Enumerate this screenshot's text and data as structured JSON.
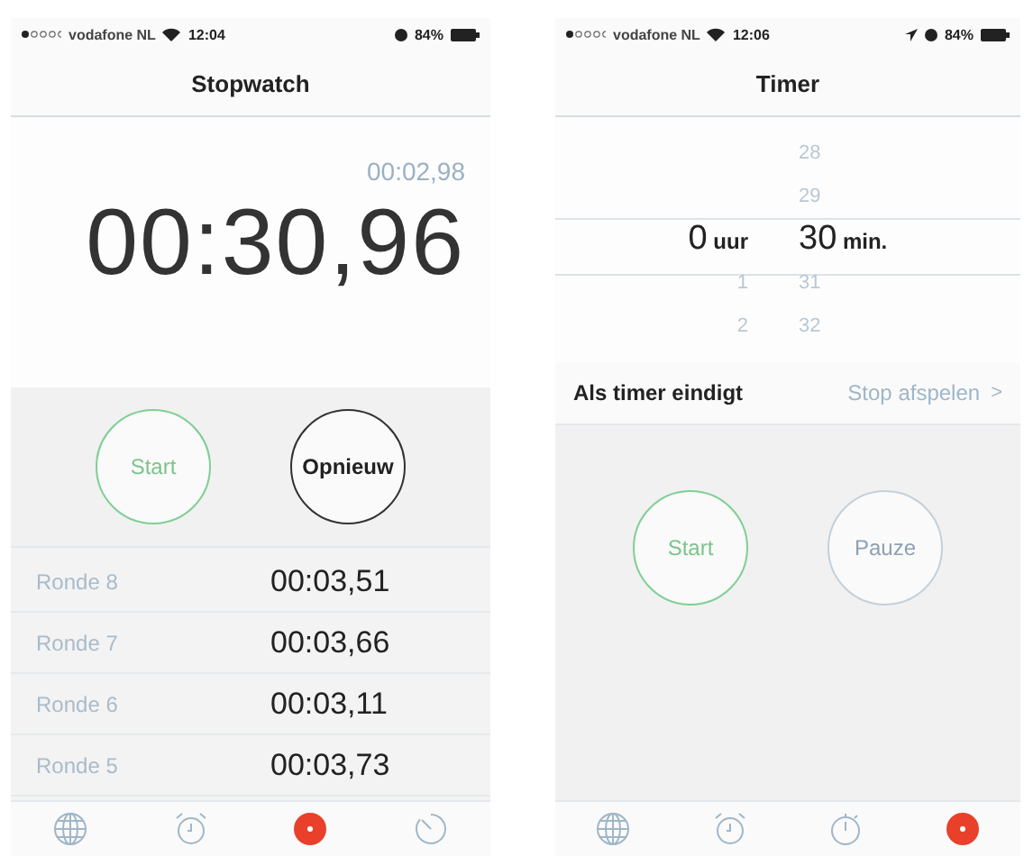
{
  "screens": [
    {
      "kind": "stopwatch",
      "status": {
        "carrier": "vodafone NL",
        "time": "12:04",
        "battery": "84%",
        "location": false
      },
      "title": "Stopwatch",
      "lap_time": "00:02,98",
      "main_time": "00:30,96",
      "buttons": [
        {
          "label": "Start",
          "kind": "go"
        },
        {
          "label": "Opnieuw",
          "kind": "dark"
        }
      ],
      "laps": [
        {
          "name": "Ronde 8",
          "time": "00:03,51"
        },
        {
          "name": "Ronde 7",
          "time": "00:03,66"
        },
        {
          "name": "Ronde 6",
          "time": "00:03,11"
        },
        {
          "name": "Ronde 5",
          "time": "00:03,73"
        }
      ],
      "tabs": [
        {
          "selected": false
        },
        {
          "selected": false
        },
        {
          "selected": true
        },
        {
          "selected": false
        }
      ]
    },
    {
      "kind": "timer",
      "status": {
        "carrier": "vodafone NL",
        "time": "12:06",
        "battery": "84%",
        "location": true
      },
      "title": "Timer",
      "picker": [
        {
          "unit": "uur",
          "items": [
            {
              "value": "0",
              "selected": true
            },
            {
              "value": "1",
              "selected": false
            },
            {
              "value": "2",
              "selected": false
            }
          ]
        },
        {
          "unit": "min.",
          "items": [
            {
              "value": "28",
              "selected": false
            },
            {
              "value": "29",
              "selected": false
            },
            {
              "value": "30",
              "selected": true
            },
            {
              "value": "31",
              "selected": false
            },
            {
              "value": "32",
              "selected": false
            }
          ]
        }
      ],
      "end_row": {
        "label": "Als timer eindigt",
        "value": "Stop afspelen",
        "chevron": ">"
      },
      "buttons": [
        {
          "label": "Start",
          "kind": "go"
        },
        {
          "label": "Pauze",
          "kind": "muted"
        }
      ],
      "tabs": [
        {
          "selected": false
        },
        {
          "selected": false
        },
        {
          "selected": false
        },
        {
          "selected": true
        }
      ]
    }
  ]
}
